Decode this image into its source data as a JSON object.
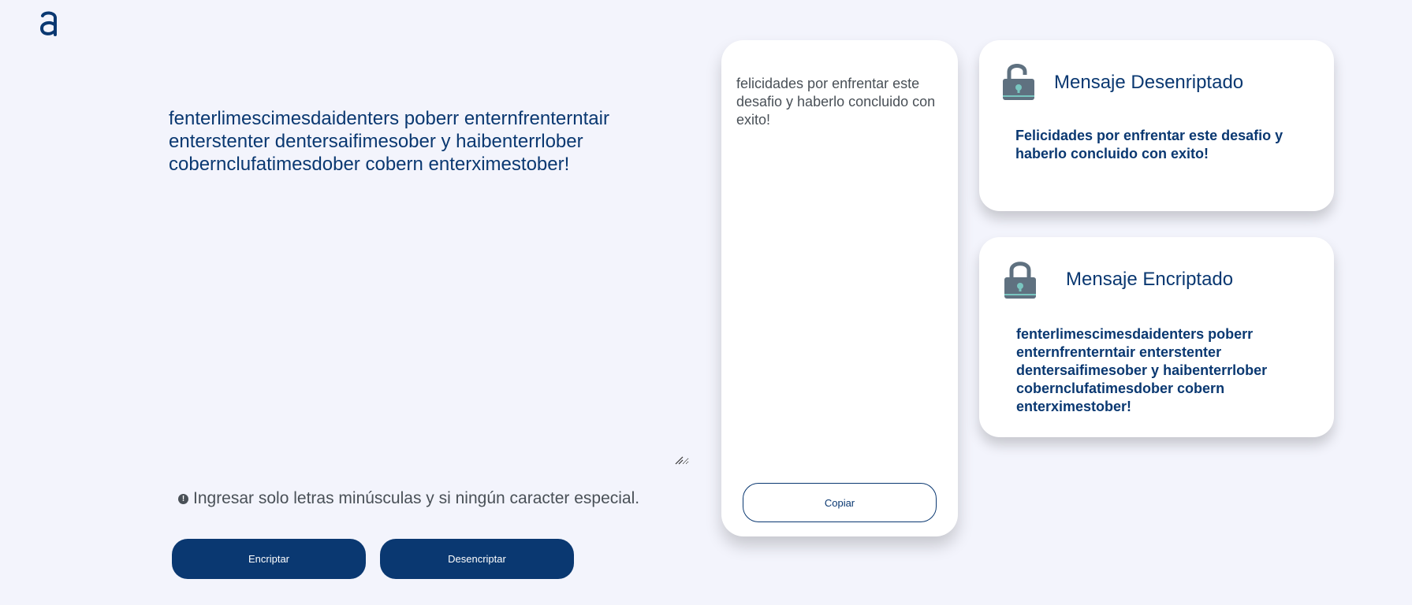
{
  "logo": {
    "name": "alura-logo"
  },
  "editor": {
    "text": "fenterlimescimesdaidenters poberr enternfrenterntair enterstenter dentersaifimesober y haibenterrlober cobernclufatimesdober cobern enterximestober!"
  },
  "warning": {
    "icon": "info-icon",
    "text": "Ingresar solo letras minúsculas y si ningún caracter especial."
  },
  "buttons": {
    "encrypt_label": "Encriptar",
    "decrypt_label": "Desencriptar"
  },
  "output": {
    "text": "felicidades por enfrentar este desafio y haberlo concluido con exito!",
    "copy_label": "Copiar"
  },
  "cards": [
    {
      "icon": "unlocked-padlock-icon",
      "title": "Mensaje Desenriptado",
      "body": "Felicidades por enfrentar este desafio y haberlo concluido con exito!"
    },
    {
      "icon": "locked-padlock-icon",
      "title": "Mensaje Encriptado",
      "body": "fenterlimescimesdaidenters poberr enternfrenterntair enterstenter dentersaifimesober y haibenterrlober cobernclufatimesdober cobern enterximestober!"
    }
  ],
  "colors": {
    "background": "#f3f4fc",
    "primary": "#0a3871",
    "muted_text": "#495057",
    "lock_body": "#5f7180",
    "lock_accent": "#79c6c0"
  }
}
